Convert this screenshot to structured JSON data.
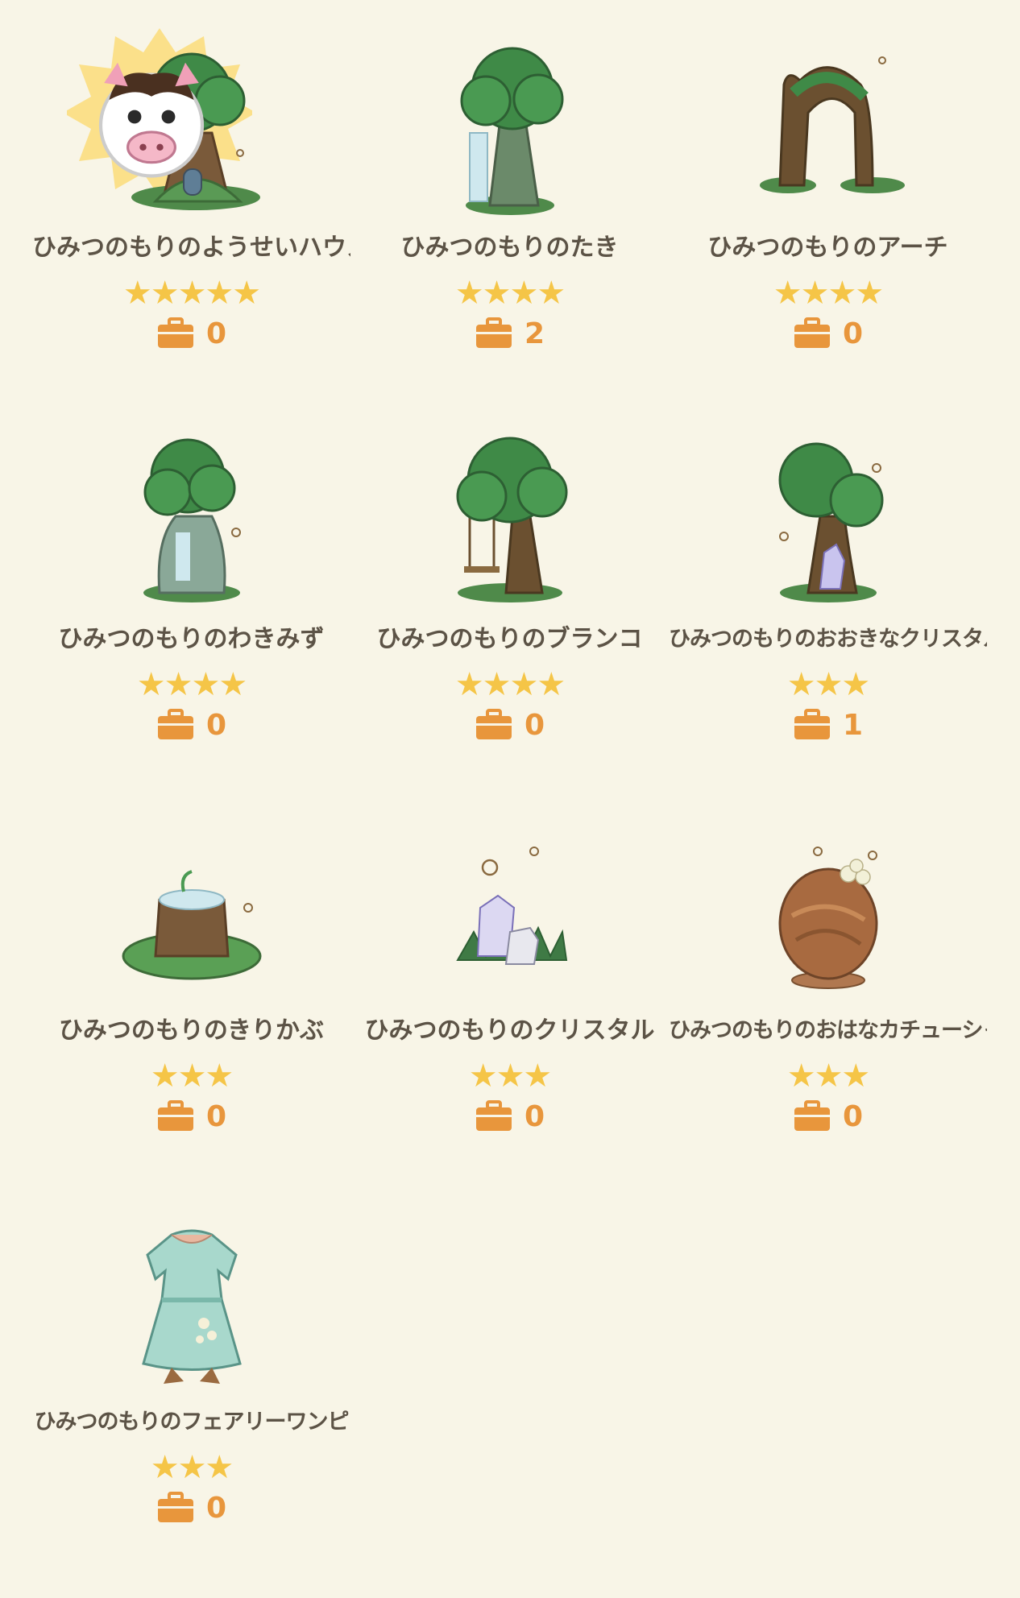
{
  "items": [
    {
      "name": "ひみつのもりのようせいハウス",
      "stars": "★★★★★",
      "count": "0",
      "icon": "tree-house-icon",
      "highlighted": true
    },
    {
      "name": "ひみつのもりのたき",
      "stars": "★★★★",
      "count": "2",
      "icon": "tree-waterfall-icon"
    },
    {
      "name": "ひみつのもりのアーチ",
      "stars": "★★★★",
      "count": "0",
      "icon": "tree-arch-icon"
    },
    {
      "name": "ひみつのもりのわきみず",
      "stars": "★★★★",
      "count": "0",
      "icon": "tree-spring-icon"
    },
    {
      "name": "ひみつのもりのブランコ",
      "stars": "★★★★",
      "count": "0",
      "icon": "tree-swing-icon"
    },
    {
      "name": "ひみつのもりのおおきなクリスタル",
      "stars": "★★★",
      "count": "1",
      "icon": "tree-crystal-icon"
    },
    {
      "name": "ひみつのもりのきりかぶ",
      "stars": "★★★",
      "count": "0",
      "icon": "stump-icon"
    },
    {
      "name": "ひみつのもりのクリスタル",
      "stars": "★★★",
      "count": "0",
      "icon": "crystal-icon"
    },
    {
      "name": "ひみつのもりのおはなカチューシャ",
      "stars": "★★★",
      "count": "0",
      "icon": "flower-headband-icon"
    },
    {
      "name": "ひみつのもりのフェアリーワンピ",
      "stars": "★★★",
      "count": "0",
      "icon": "fairy-dress-icon"
    }
  ],
  "colors": {
    "background": "#f8f5e7",
    "star": "#f5c547",
    "count": "#e8963c",
    "text": "#5c5346",
    "highlight": "#fbe08a"
  }
}
